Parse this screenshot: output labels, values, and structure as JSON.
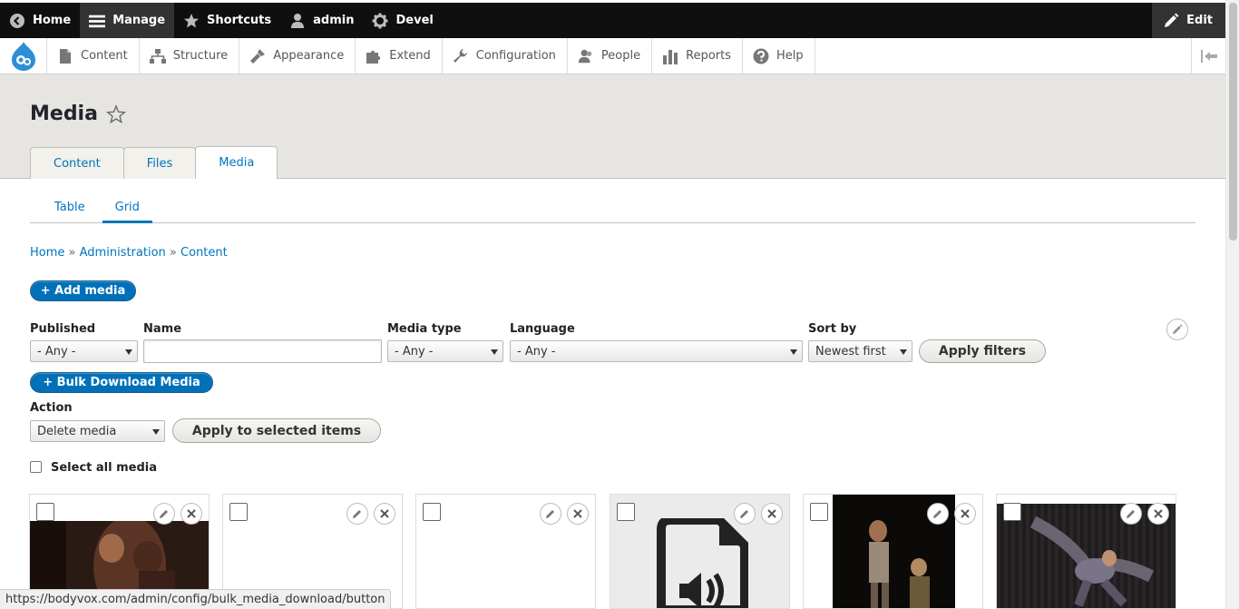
{
  "toolbar": {
    "home": "Home",
    "manage": "Manage",
    "shortcuts": "Shortcuts",
    "user": "admin",
    "devel": "Devel",
    "edit": "Edit"
  },
  "tray": {
    "items": [
      "Content",
      "Structure",
      "Appearance",
      "Extend",
      "Configuration",
      "People",
      "Reports",
      "Help"
    ]
  },
  "page": {
    "title": "Media",
    "primary_tabs": [
      "Content",
      "Files",
      "Media"
    ],
    "secondary_tabs": [
      "Table",
      "Grid"
    ]
  },
  "breadcrumb": {
    "items": [
      "Home",
      "Administration",
      "Content"
    ],
    "separator": "»"
  },
  "buttons": {
    "add_media": "+ Add media",
    "apply_filters": "Apply filters",
    "bulk_download": "+  Bulk Download Media",
    "apply_selected": "Apply to selected items"
  },
  "filters": {
    "published_label": "Published",
    "published_value": "- Any -",
    "name_label": "Name",
    "name_value": "",
    "media_type_label": "Media type",
    "media_type_value": "- Any -",
    "language_label": "Language",
    "language_value": "- Any -",
    "sort_label": "Sort by",
    "sort_value": "Newest first"
  },
  "bulk": {
    "action_label": "Action",
    "action_value": "Delete media",
    "select_all_label": "Select all media"
  },
  "status_url": "https://bodyvox.com/admin/config/bulk_media_download/button",
  "colors": {
    "toolbar_bg": "#0f0f0f",
    "link": "#0074bd",
    "primary_button": "#0071b8",
    "header_bg": "#e6e5e1"
  }
}
